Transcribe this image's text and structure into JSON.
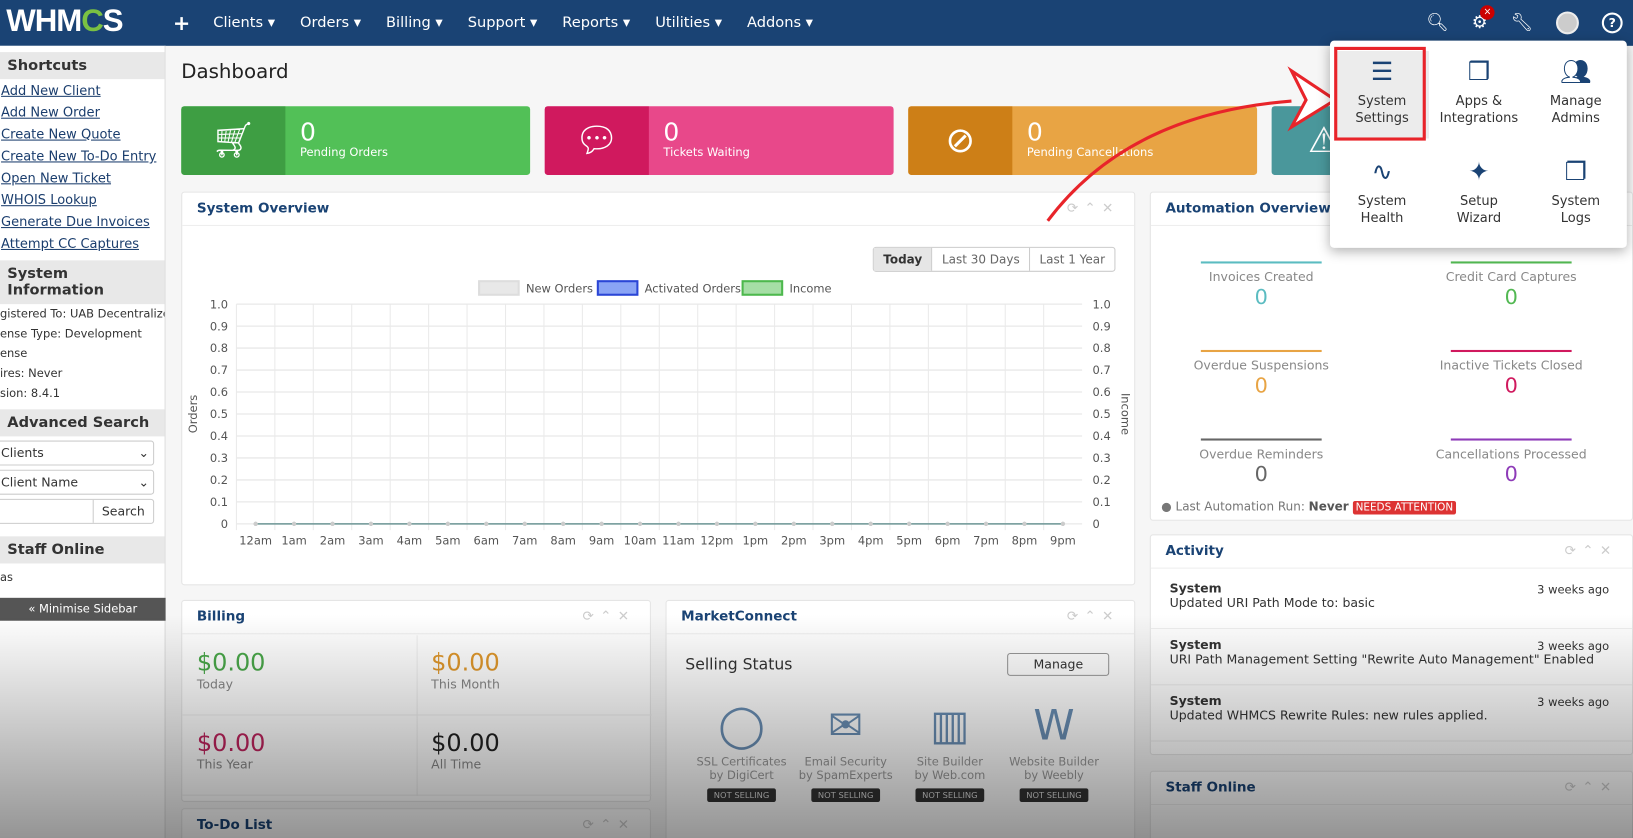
{
  "nav": {
    "logo": "WHMCS",
    "items": [
      "Clients",
      "Orders",
      "Billing",
      "Support",
      "Reports",
      "Utilities",
      "Addons"
    ],
    "notification_badge": "×"
  },
  "sidebar": {
    "shortcuts_title": "Shortcuts",
    "shortcuts": [
      "Add New Client",
      "Add New Order",
      "Create New Quote",
      "Create New To-Do Entry",
      "Open New Ticket",
      "WHOIS Lookup",
      "Generate Due Invoices",
      "Attempt CC Captures"
    ],
    "sysinfo_title": "System Information",
    "sysinfo": [
      "gistered To: UAB Decentralized",
      "ense Type: Development",
      "ense",
      "ires: Never",
      "sion: 8.4.1"
    ],
    "search_title": "Advanced Search",
    "search_type": "Clients",
    "search_field": "Client Name",
    "search_button": "Search",
    "staff_title": "Staff Online",
    "staff": "as",
    "minimise": "« Minimise Sidebar"
  },
  "page_title": "Dashboard",
  "stats": [
    {
      "value": "0",
      "label": "Pending Orders",
      "color": "#52c057",
      "dark": "#3e9e43",
      "icon": "cart-icon"
    },
    {
      "value": "0",
      "label": "Tickets Waiting",
      "color": "#e8488a",
      "dark": "#d0195e",
      "icon": "chat-icon"
    },
    {
      "value": "0",
      "label": "Pending Cancellations",
      "color": "#e8a444",
      "dark": "#cd7f17",
      "icon": "ban-icon"
    },
    {
      "value": "",
      "label": "",
      "color": "#5ea9ad",
      "dark": "#4a979b",
      "icon": "warning-icon"
    }
  ],
  "system_overview": {
    "title": "System Overview",
    "ranges": [
      "Today",
      "Last 30 Days",
      "Last 1 Year"
    ]
  },
  "chart_data": {
    "type": "line",
    "categories": [
      "12am",
      "1am",
      "2am",
      "3am",
      "4am",
      "5am",
      "6am",
      "7am",
      "8am",
      "9am",
      "10am",
      "11am",
      "12pm",
      "1pm",
      "2pm",
      "3pm",
      "4pm",
      "5pm",
      "6pm",
      "7pm",
      "8pm",
      "9pm"
    ],
    "series": [
      {
        "name": "New Orders",
        "values": [
          0,
          0,
          0,
          0,
          0,
          0,
          0,
          0,
          0,
          0,
          0,
          0,
          0,
          0,
          0,
          0,
          0,
          0,
          0,
          0,
          0,
          0
        ],
        "color": "#dddddd"
      },
      {
        "name": "Activated Orders",
        "values": [
          0,
          0,
          0,
          0,
          0,
          0,
          0,
          0,
          0,
          0,
          0,
          0,
          0,
          0,
          0,
          0,
          0,
          0,
          0,
          0,
          0,
          0
        ],
        "color": "#3050e0"
      },
      {
        "name": "Income",
        "values": [
          0,
          0,
          0,
          0,
          0,
          0,
          0,
          0,
          0,
          0,
          0,
          0,
          0,
          0,
          0,
          0,
          0,
          0,
          0,
          0,
          0,
          0
        ],
        "color": "#4db84d"
      }
    ],
    "ylabel": "Orders",
    "y2label": "Income",
    "ylim": [
      0,
      1
    ],
    "yticks": [
      "0",
      "0.1",
      "0.2",
      "0.3",
      "0.4",
      "0.5",
      "0.6",
      "0.7",
      "0.8",
      "0.9",
      "1.0"
    ],
    "grid": true,
    "legend": "top"
  },
  "automation": {
    "title": "Automation Overview",
    "items": [
      {
        "label": "Invoices Created",
        "value": "0",
        "color": "#5bbcc1"
      },
      {
        "label": "Credit Card Captures",
        "value": "0",
        "color": "#52b852"
      },
      {
        "label": "Overdue Suspensions",
        "value": "0",
        "color": "#e8a444"
      },
      {
        "label": "Inactive Tickets Closed",
        "value": "0",
        "color": "#d0195e"
      },
      {
        "label": "Overdue Reminders",
        "value": "0",
        "color": "#666666"
      },
      {
        "label": "Cancellations Processed",
        "value": "0",
        "color": "#8e3bb8"
      }
    ],
    "last_run_label": "Last Automation Run:",
    "last_run": "Never",
    "attention": "NEEDS ATTENTION"
  },
  "activity": {
    "title": "Activity",
    "items": [
      {
        "who": "System",
        "time": "3 weeks ago",
        "text": "Updated URI Path Mode to: basic"
      },
      {
        "who": "System",
        "time": "3 weeks ago",
        "text": "URI Path Management Setting \"Rewrite Auto Management\" Enabled"
      },
      {
        "who": "System",
        "time": "3 weeks ago",
        "text": "Updated WHMCS Rewrite Rules: new rules applied."
      }
    ]
  },
  "staff_online_title": "Staff Online",
  "billing": {
    "title": "Billing",
    "items": [
      {
        "value": "$0.00",
        "label": "Today",
        "color": "#4aa84a"
      },
      {
        "value": "$0.00",
        "label": "This Month",
        "color": "#e0982c"
      },
      {
        "value": "$0.00",
        "label": "This Year",
        "color": "#c0245e"
      },
      {
        "value": "$0.00",
        "label": "All Time",
        "color": "#222222"
      }
    ]
  },
  "todo_title": "To-Do List",
  "marketconnect": {
    "title": "MarketConnect",
    "heading": "Selling Status",
    "manage": "Manage",
    "products": [
      {
        "l1": "SSL Certificates",
        "l2": "by DigiCert",
        "status": "NOT SELLING"
      },
      {
        "l1": "Email Security",
        "l2": "by SpamExperts",
        "status": "NOT SELLING"
      },
      {
        "l1": "Site Builder",
        "l2": "by Web.com",
        "status": "NOT SELLING"
      },
      {
        "l1": "Website Builder",
        "l2": "by Weebly",
        "status": "NOT SELLING"
      }
    ]
  },
  "dropdown": [
    {
      "label": "System Settings",
      "icon": "sliders-icon"
    },
    {
      "label": "Apps & Integrations",
      "icon": "cubes-icon"
    },
    {
      "label": "Manage Admins",
      "icon": "users-icon"
    },
    {
      "label": "System Health",
      "icon": "heartbeat-icon"
    },
    {
      "label": "Setup Wizard",
      "icon": "magic-wand-icon"
    },
    {
      "label": "System Logs",
      "icon": "files-icon"
    }
  ]
}
